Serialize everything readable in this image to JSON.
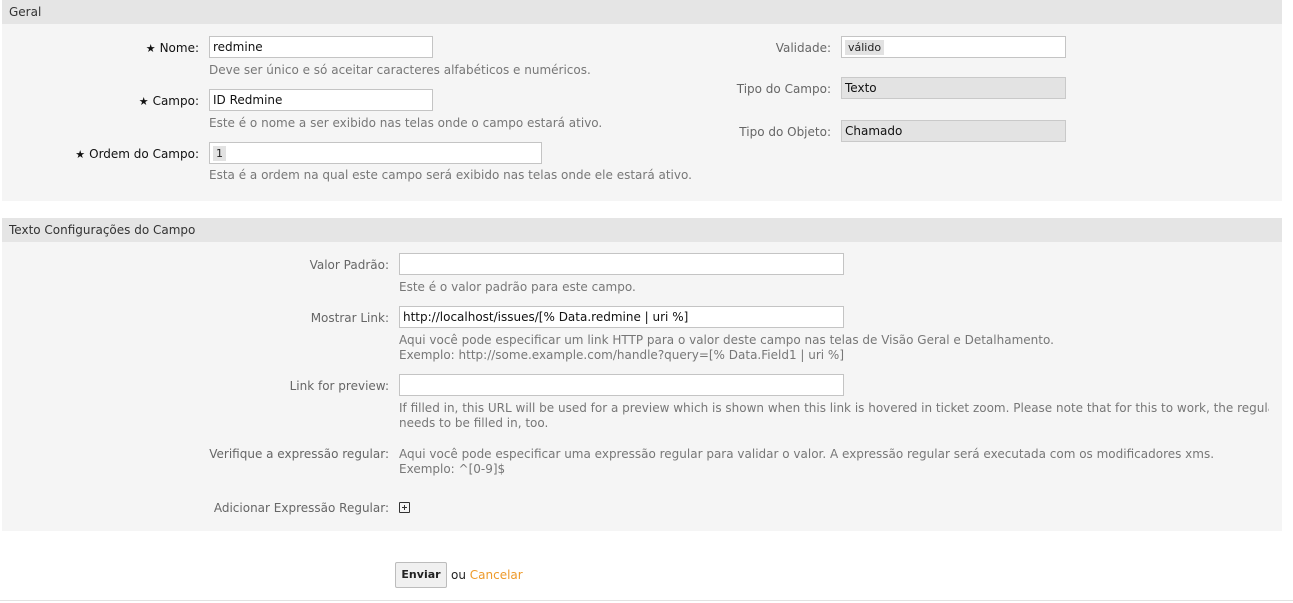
{
  "general": {
    "header": "Geral",
    "name_label": "Nome:",
    "name_value": "redmine",
    "name_hint": "Deve ser único e só aceitar caracteres alfabéticos e numéricos.",
    "field_label": "Campo:",
    "field_value": "ID Redmine",
    "field_hint": "Este é o nome a ser exibido nas telas onde o campo estará ativo.",
    "order_label": "Ordem do Campo:",
    "order_value": "1",
    "order_hint": "Esta é a ordem na qual este campo será exibido nas telas onde ele estará ativo.",
    "validity_label": "Validade:",
    "validity_value": "válido",
    "field_type_label": "Tipo do Campo:",
    "field_type_value": "Texto",
    "object_type_label": "Tipo do Objeto:",
    "object_type_value": "Chamado",
    "required_mark": "★"
  },
  "text_settings": {
    "header": "Texto Configurações do Campo",
    "default_label": "Valor Padrão:",
    "default_value": "",
    "default_hint": "Este é o valor padrão para este campo.",
    "link_label": "Mostrar Link:",
    "link_value": "http://localhost/issues/[% Data.redmine | uri %]",
    "link_hint_1": "Aqui você pode especificar um link HTTP para o valor deste campo nas telas de Visão Geral e Detalhamento.",
    "link_hint_2": "Exemplo: http://some.example.com/handle?query=[% Data.Field1 | uri %]",
    "preview_label": "Link for preview:",
    "preview_value": "",
    "preview_hint_1": "If filled in, this URL will be used for a preview which is shown when this link is hovered in ticket zoom. Please note that for this to work, the regular URL field above",
    "preview_hint_2": "needs to be filled in, too.",
    "regex_label": "Verifique a expressão regular:",
    "regex_hint_1": "Aqui você pode especificar uma expressão regular para validar o valor. A expressão regular será executada com os modificadores xms.",
    "regex_hint_2": "Exemplo: ^[0-9]$",
    "add_regex_label": "Adicionar Expressão Regular:"
  },
  "actions": {
    "submit_label": "Enviar",
    "or_text": "ou",
    "cancel_label": "Cancelar"
  }
}
